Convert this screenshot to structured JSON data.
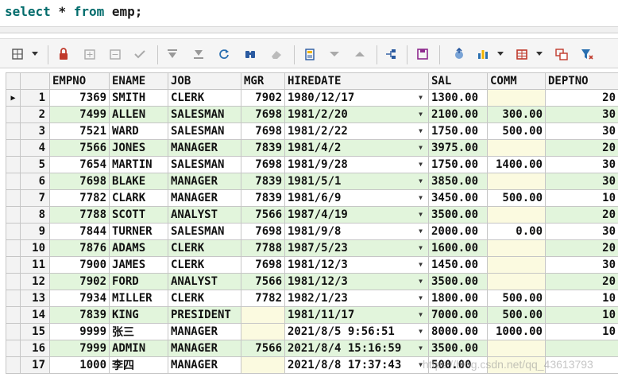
{
  "editor": {
    "sql_keyword_select": "select",
    "sql_star": "*",
    "sql_keyword_from": "from",
    "sql_table": "emp;"
  },
  "toolbar": {
    "icons": [
      "grid-mode-icon",
      "lock-icon",
      "add-record-icon",
      "delete-record-icon",
      "post-edit-icon",
      "first-record-icon",
      "last-record-icon",
      "refresh-icon",
      "find-icon",
      "clear-icon",
      "query-by-example-icon",
      "next-icon",
      "previous-icon",
      "tree-view-icon",
      "save-icon",
      "export-icon",
      "chart-icon",
      "table-view-icon",
      "copy-records-icon",
      "filter-icon"
    ]
  },
  "grid": {
    "columns": [
      "EMPNO",
      "ENAME",
      "JOB",
      "MGR",
      "HIREDATE",
      "SAL",
      "COMM",
      "DEPTNO"
    ],
    "rows": [
      {
        "n": "1",
        "empno": "7369",
        "ename": "SMITH",
        "job": "CLERK",
        "mgr": "7902",
        "hiredate": "1980/12/17",
        "sal": "1300.00",
        "comm": "",
        "deptno": "20"
      },
      {
        "n": "2",
        "empno": "7499",
        "ename": "ALLEN",
        "job": "SALESMAN",
        "mgr": "7698",
        "hiredate": "1981/2/20",
        "sal": "2100.00",
        "comm": "300.00",
        "deptno": "30"
      },
      {
        "n": "3",
        "empno": "7521",
        "ename": "WARD",
        "job": "SALESMAN",
        "mgr": "7698",
        "hiredate": "1981/2/22",
        "sal": "1750.00",
        "comm": "500.00",
        "deptno": "30"
      },
      {
        "n": "4",
        "empno": "7566",
        "ename": "JONES",
        "job": "MANAGER",
        "mgr": "7839",
        "hiredate": "1981/4/2",
        "sal": "3975.00",
        "comm": "",
        "deptno": "20"
      },
      {
        "n": "5",
        "empno": "7654",
        "ename": "MARTIN",
        "job": "SALESMAN",
        "mgr": "7698",
        "hiredate": "1981/9/28",
        "sal": "1750.00",
        "comm": "1400.00",
        "deptno": "30"
      },
      {
        "n": "6",
        "empno": "7698",
        "ename": "BLAKE",
        "job": "MANAGER",
        "mgr": "7839",
        "hiredate": "1981/5/1",
        "sal": "3850.00",
        "comm": "",
        "deptno": "30"
      },
      {
        "n": "7",
        "empno": "7782",
        "ename": "CLARK",
        "job": "MANAGER",
        "mgr": "7839",
        "hiredate": "1981/6/9",
        "sal": "3450.00",
        "comm": "500.00",
        "deptno": "10"
      },
      {
        "n": "8",
        "empno": "7788",
        "ename": "SCOTT",
        "job": "ANALYST",
        "mgr": "7566",
        "hiredate": "1987/4/19",
        "sal": "3500.00",
        "comm": "",
        "deptno": "20"
      },
      {
        "n": "9",
        "empno": "7844",
        "ename": "TURNER",
        "job": "SALESMAN",
        "mgr": "7698",
        "hiredate": "1981/9/8",
        "sal": "2000.00",
        "comm": "0.00",
        "deptno": "30"
      },
      {
        "n": "10",
        "empno": "7876",
        "ename": "ADAMS",
        "job": "CLERK",
        "mgr": "7788",
        "hiredate": "1987/5/23",
        "sal": "1600.00",
        "comm": "",
        "deptno": "20"
      },
      {
        "n": "11",
        "empno": "7900",
        "ename": "JAMES",
        "job": "CLERK",
        "mgr": "7698",
        "hiredate": "1981/12/3",
        "sal": "1450.00",
        "comm": "",
        "deptno": "30"
      },
      {
        "n": "12",
        "empno": "7902",
        "ename": "FORD",
        "job": "ANALYST",
        "mgr": "7566",
        "hiredate": "1981/12/3",
        "sal": "3500.00",
        "comm": "",
        "deptno": "20"
      },
      {
        "n": "13",
        "empno": "7934",
        "ename": "MILLER",
        "job": "CLERK",
        "mgr": "7782",
        "hiredate": "1982/1/23",
        "sal": "1800.00",
        "comm": "500.00",
        "deptno": "10"
      },
      {
        "n": "14",
        "empno": "7839",
        "ename": "KING",
        "job": "PRESIDENT",
        "mgr": "",
        "hiredate": "1981/11/17",
        "sal": "7000.00",
        "comm": "500.00",
        "deptno": "10"
      },
      {
        "n": "15",
        "empno": "9999",
        "ename": "张三",
        "job": "MANAGER",
        "mgr": "",
        "hiredate": "2021/8/5 9:56:51",
        "sal": "8000.00",
        "comm": "1000.00",
        "deptno": "10"
      },
      {
        "n": "16",
        "empno": "7999",
        "ename": "ADMIN",
        "job": "MANAGER",
        "mgr": "7566",
        "hiredate": "2021/8/4 15:16:59",
        "sal": "3500.00",
        "comm": "",
        "deptno": ""
      },
      {
        "n": "17",
        "empno": "1000",
        "ename": "李四",
        "job": "MANAGER",
        "mgr": "",
        "hiredate": "2021/8/8 17:37:43",
        "sal": "500.00",
        "comm": "",
        "deptno": ""
      }
    ]
  },
  "watermark": "https://blog.csdn.net/qq_43613793",
  "colors": {
    "even_row": "#e2f5dc",
    "odd_row": "#ffffff",
    "null_cell": "#fbfae0",
    "keyword": "#006b6b"
  }
}
